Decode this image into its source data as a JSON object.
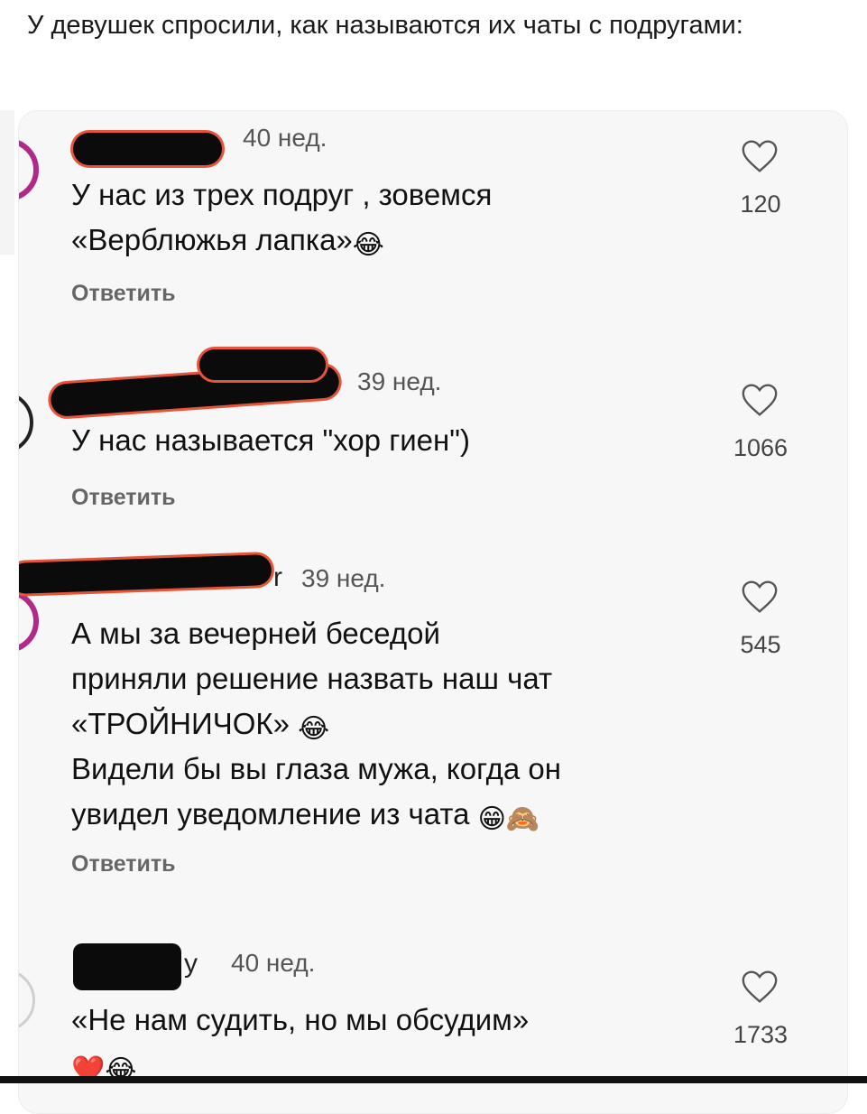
{
  "caption": "У девушек спросили, как называются их чаты с подругами:",
  "reply_label": "Ответить",
  "comments": [
    {
      "time": "40 нед.",
      "name_tail": "",
      "lines": [
        "У нас из трех подруг , зовемся",
        "«Верблюжья лапка»"
      ],
      "emojis": [
        "😂"
      ],
      "likes": "120"
    },
    {
      "time": "39 нед.",
      "name_tail": "",
      "lines": [
        "У нас называется \"хор гиен\")"
      ],
      "emojis": [],
      "likes": "1066"
    },
    {
      "time": "39 нед.",
      "name_tail": "r",
      "lines": [
        "А мы за вечерней беседой",
        "приняли решение назвать наш чат",
        "«ТРОЙНИЧОК»",
        "Видели бы вы глаза мужа, когда он",
        "увидел уведомление из чата"
      ],
      "emojis": [
        "😂",
        "😁",
        "🙈"
      ],
      "likes": "545"
    },
    {
      "time": "40 нед.",
      "name_tail": "y",
      "lines": [
        "«Не нам судить, но мы обсудим»"
      ],
      "emojis": [
        "❤️",
        "😂"
      ],
      "likes": "1733"
    }
  ],
  "colors": {
    "background": "#ffffff",
    "card": "#f7f7f7",
    "redaction": "#0b0b0b",
    "redaction_outline": "#e6553a",
    "avatar_ring": "#b02a8a",
    "text": "#111111",
    "muted": "#666666"
  },
  "icons": {
    "like": "heart-outline-icon",
    "laugh": "face-with-tears-of-joy-emoji",
    "grin": "grinning-face-emoji",
    "see_no_evil": "see-no-evil-monkey-emoji",
    "heart": "red-heart-emoji"
  }
}
